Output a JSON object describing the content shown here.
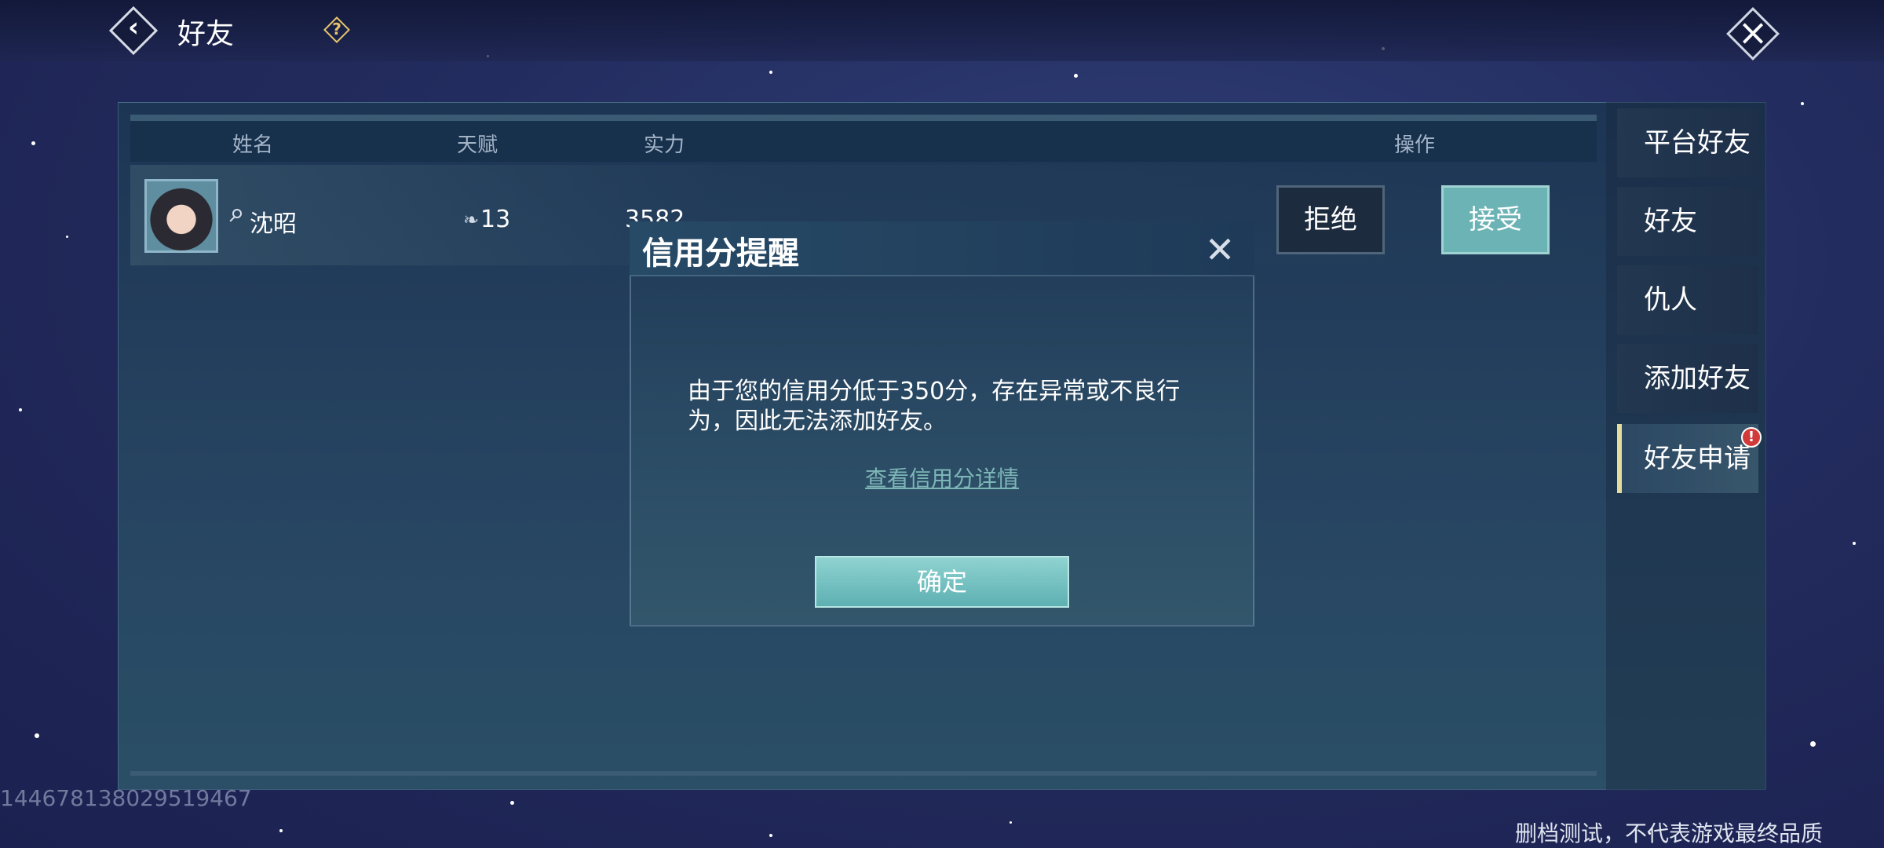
{
  "header": {
    "title": "好友"
  },
  "table": {
    "headers": {
      "name": "姓名",
      "talent": "天赋",
      "power": "实力",
      "action": "操作"
    },
    "rows": [
      {
        "name": "沈昭",
        "talent": "13",
        "power": "3582",
        "reject_label": "拒绝",
        "accept_label": "接受"
      }
    ]
  },
  "tabs": [
    {
      "label": "平台好友"
    },
    {
      "label": "好友"
    },
    {
      "label": "仇人"
    },
    {
      "label": "添加好友"
    },
    {
      "label": "好友申请",
      "active": true,
      "badge": "!"
    }
  ],
  "dialog": {
    "title": "信用分提醒",
    "message": "由于您的信用分低于350分，存在异常或不良行为，因此无法添加好友。",
    "link": "查看信用分详情",
    "confirm_label": "确定"
  },
  "footer": {
    "uid": "1446781380295194​67",
    "disclaimer": "删档测试，不代表游戏最终品质"
  }
}
